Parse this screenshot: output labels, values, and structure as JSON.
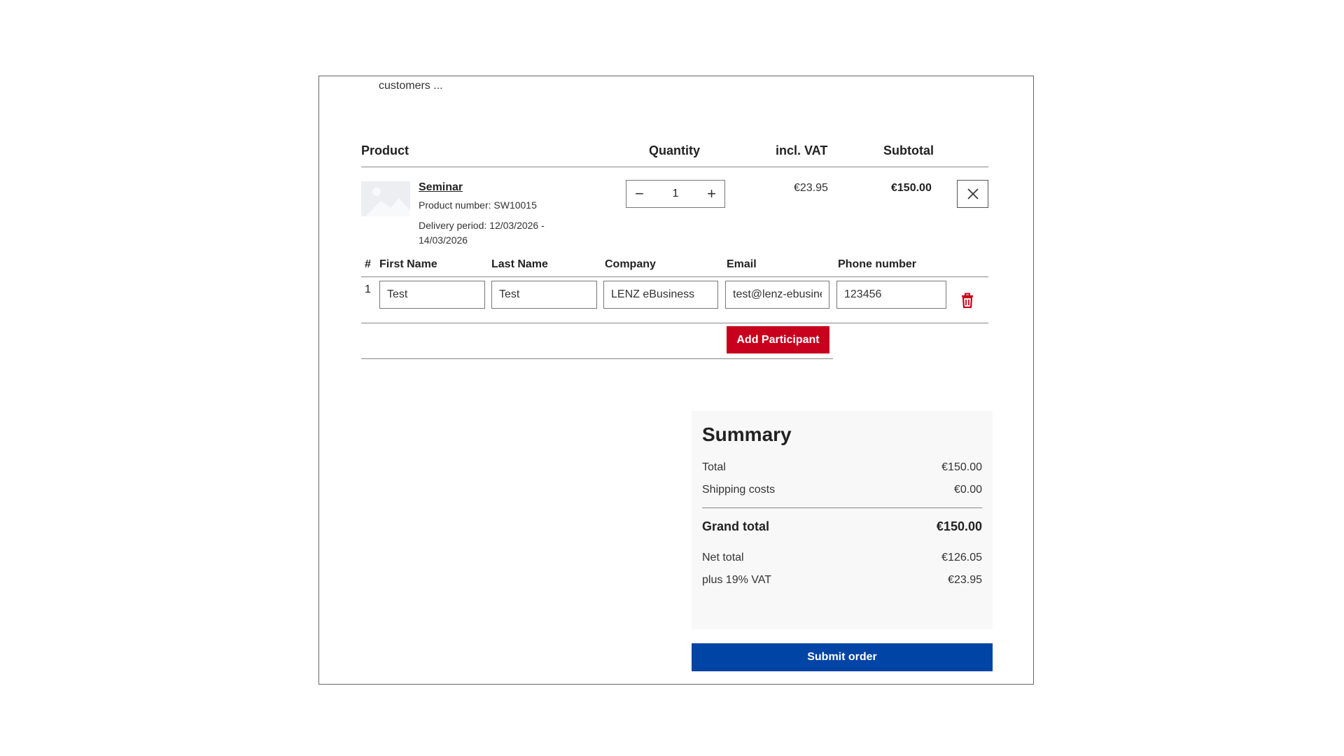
{
  "intro_text": "customers ...",
  "table_headers": {
    "product": "Product",
    "quantity": "Quantity",
    "incl_vat": "incl. VAT",
    "subtotal": "Subtotal"
  },
  "line_item": {
    "title": "Seminar",
    "product_number": "Product number: SW10015",
    "delivery_line1": "Delivery period: 12/03/2026 -",
    "delivery_line2": "14/03/2026",
    "quantity": "1",
    "minus_label": "−",
    "plus_label": "+",
    "vat_price": "€23.95",
    "subtotal": "€150.00"
  },
  "participants": {
    "headers": {
      "num": "#",
      "first_name": "First Name",
      "last_name": "Last Name",
      "company": "Company",
      "email": "Email",
      "phone": "Phone number"
    },
    "rows": [
      {
        "index": "1",
        "first_name": "Test",
        "last_name": "Test",
        "company": "LENZ eBusiness",
        "email": "test@lenz-ebusiness.de",
        "phone": "123456"
      }
    ],
    "add_label": "Add Participant"
  },
  "summary": {
    "title": "Summary",
    "total_label": "Total",
    "total_value": "€150.00",
    "shipping_label": "Shipping costs",
    "shipping_value": "€0.00",
    "grand_label": "Grand total",
    "grand_value": "€150.00",
    "net_label": "Net total",
    "net_value": "€126.05",
    "vat_label": "plus 19% VAT",
    "vat_value": "€23.95"
  },
  "submit_label": "Submit order",
  "colors": {
    "accent_red": "#c8001e",
    "accent_blue": "#0044a5"
  }
}
